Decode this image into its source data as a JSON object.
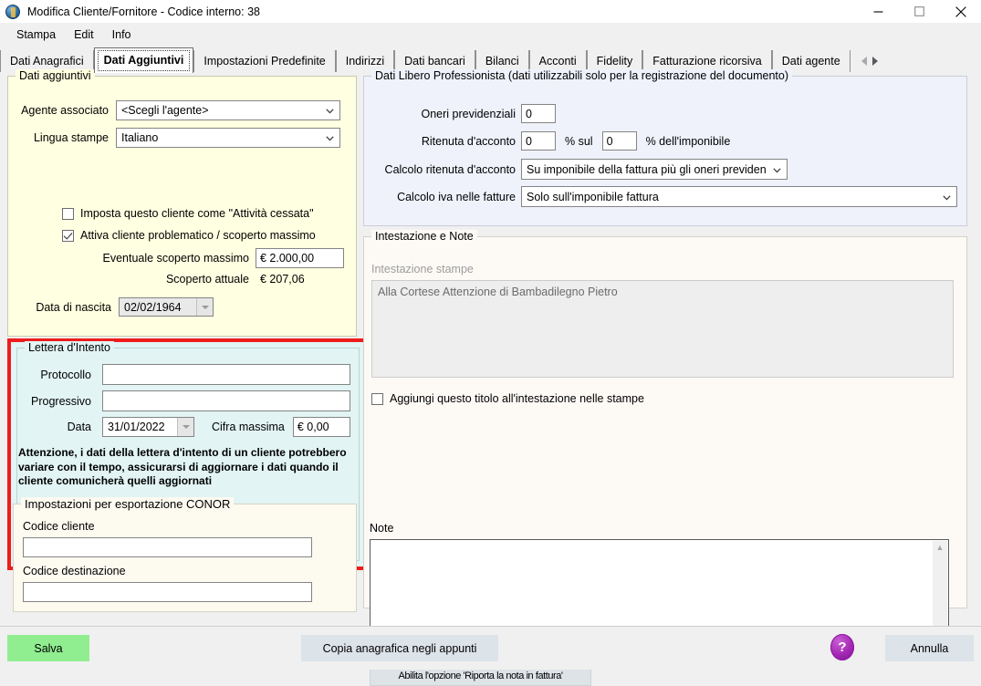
{
  "window": {
    "title": "Modifica Cliente/Fornitore - Codice interno: 38",
    "app_icon": "globe-icon",
    "minimize": "minimize-icon",
    "maximize": "maximize-icon",
    "close": "close-icon"
  },
  "menu": {
    "items": [
      {
        "label": "Stampa"
      },
      {
        "label": "Edit"
      },
      {
        "label": "Info"
      }
    ]
  },
  "tabs": {
    "items": [
      {
        "label": "Dati Anagrafici",
        "active": false
      },
      {
        "label": "Dati Aggiuntivi",
        "active": true
      },
      {
        "label": "Impostazioni Predefinite",
        "active": false
      },
      {
        "label": "Indirizzi",
        "active": false
      },
      {
        "label": "Dati bancari",
        "active": false
      },
      {
        "label": "Bilanci",
        "active": false
      },
      {
        "label": "Acconti",
        "active": false
      },
      {
        "label": "Fidelity",
        "active": false
      },
      {
        "label": "Fatturazione ricorsiva",
        "active": false
      },
      {
        "label": "Dati agente",
        "active": false
      }
    ],
    "scroll_left": "chevron-left-icon",
    "scroll_right": "chevron-right-icon"
  },
  "dati_aggiuntivi": {
    "legend": "Dati aggiuntivi",
    "agente_label": "Agente associato",
    "agente_value": "<Scegli l'agente>",
    "lingua_label": "Lingua stampe",
    "lingua_value": "Italiano",
    "chk_attivita_cessata": {
      "label": "Imposta questo cliente come \"Attività cessata\"",
      "checked": false
    },
    "chk_cliente_problematico": {
      "label": "Attiva cliente problematico / scoperto massimo",
      "checked": true
    },
    "scoperto_massimo_label": "Eventuale scoperto massimo",
    "scoperto_massimo_value": "€ 2.000,00",
    "scoperto_attuale_label": "Scoperto attuale",
    "scoperto_attuale_value": "€ 207,06",
    "data_nascita_label": "Data di nascita",
    "data_nascita_value": "02/02/1964"
  },
  "lettera_intento": {
    "legend": "Lettera d'Intento",
    "protocollo_label": "Protocollo",
    "protocollo_value": "",
    "progressivo_label": "Progressivo",
    "progressivo_value": "",
    "data_label": "Data",
    "data_value": "31/01/2022",
    "cifra_label": "Cifra massima",
    "cifra_value": "€ 0,00",
    "warning": "Attenzione, i dati della lettera d'intento di un cliente potrebbero variare con il tempo, assicurarsi di aggiornare i dati quando il cliente comunicherà quelli aggiornati",
    "highlight_color": "#ee1c1c"
  },
  "conor": {
    "legend": "Impostazioni per esportazione CONOR",
    "codice_cliente_label": "Codice cliente",
    "codice_cliente_value": "",
    "codice_destinazione_label": "Codice destinazione",
    "codice_destinazione_value": ""
  },
  "libero_professionista": {
    "legend": "Dati Libero Professionista (dati utilizzabili solo per la registrazione del documento)",
    "oneri_label": "Oneri previdenziali",
    "oneri_value": "0",
    "ritenuta_label": "Ritenuta d'acconto",
    "ritenuta_value": "0",
    "percent_sul": "% sul",
    "ritenuta_base_value": "0",
    "percent_imponibile": "% dell'imponibile",
    "calcolo_ritenuta_label": "Calcolo ritenuta d'acconto",
    "calcolo_ritenuta_value": "Su imponibile della fattura più gli oneri previden",
    "calcolo_iva_label": "Calcolo iva nelle fatture",
    "calcolo_iva_value": "Solo sull'imponibile fattura"
  },
  "intestazione_note": {
    "legend": "Intestazione e Note",
    "intestazione_label": "Intestazione stampe",
    "intestazione_value": "Alla Cortese Attenzione di Bambadilegno Pietro",
    "chk_aggiungi_titolo": {
      "label": "Aggiungi questo titolo all'intestazione nelle stampe",
      "checked": false
    },
    "note_label": "Note",
    "note_value": "",
    "abilita_button": "Abilita l'opzione 'Riporta la nota in fattura'",
    "scroll_up": "scroll-up-arrow",
    "scroll_down": "scroll-down-arrow"
  },
  "footer": {
    "save_label": "Salva",
    "save_color": "#90ee90",
    "copy_label": "Copia anagrafica negli appunti",
    "help_label": "?",
    "help_color": "#a327b4",
    "cancel_label": "Annulla"
  }
}
